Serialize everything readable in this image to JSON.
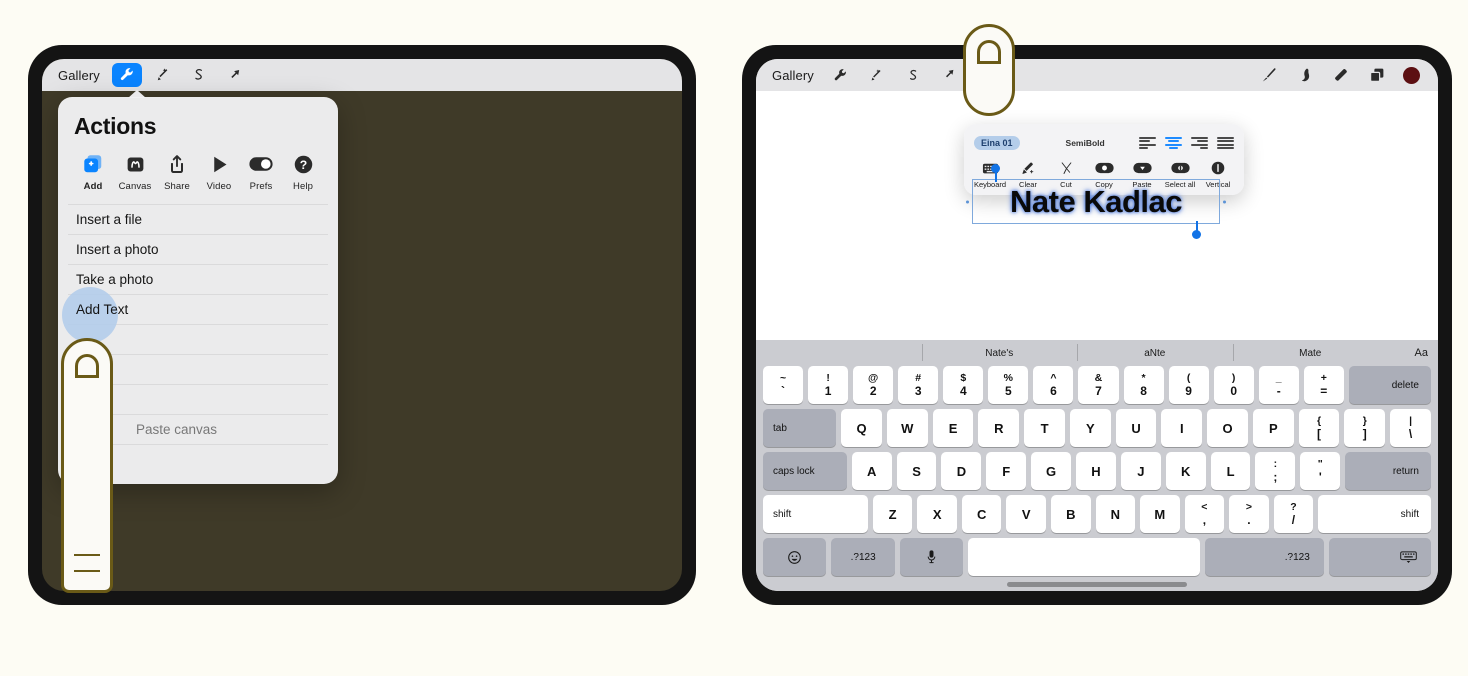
{
  "page": {
    "background_color": "#FDFCF4"
  },
  "left_device": {
    "canvas_color": "#3F3A28",
    "toolbar": {
      "gallery_label": "Gallery",
      "tools": [
        {
          "name": "wrench-icon",
          "label": "Actions",
          "active": true
        },
        {
          "name": "magic-wand-icon",
          "label": "Adjustments",
          "active": false
        },
        {
          "name": "selection-icon",
          "label": "Selection",
          "active": false
        },
        {
          "name": "transform-arrow-icon",
          "label": "Transform",
          "active": false
        }
      ]
    },
    "actions_panel": {
      "title": "Actions",
      "icons": [
        {
          "name": "add-icon",
          "label": "Add",
          "active": true
        },
        {
          "name": "canvas-icon",
          "label": "Canvas",
          "active": false
        },
        {
          "name": "share-icon",
          "label": "Share",
          "active": false
        },
        {
          "name": "video-icon",
          "label": "Video",
          "active": false
        },
        {
          "name": "prefs-icon",
          "label": "Prefs",
          "active": false
        },
        {
          "name": "help-icon",
          "label": "Help",
          "active": false
        }
      ],
      "menu_items": [
        {
          "label": "Insert a file",
          "state": "normal"
        },
        {
          "label": "Insert a photo",
          "state": "normal"
        },
        {
          "label": "Take a photo",
          "state": "normal"
        },
        {
          "label": "Add Text",
          "state": "highlighted"
        },
        {
          "label": "",
          "state": "blank"
        },
        {
          "label": "",
          "state": "blank"
        },
        {
          "label": "",
          "state": "blank"
        },
        {
          "label": "Paste canvas",
          "state": "faded"
        },
        {
          "label": "",
          "state": "blank"
        }
      ]
    },
    "stylus_cursor": {
      "name": "apple-pencil-cursor"
    }
  },
  "right_device": {
    "canvas_color": "#FFFFFF",
    "toolbar": {
      "gallery_label": "Gallery",
      "tools": [
        {
          "name": "wrench-icon",
          "label": "Actions",
          "active": false
        },
        {
          "name": "magic-wand-icon",
          "label": "Adjustments",
          "active": false
        },
        {
          "name": "selection-icon",
          "label": "Selection",
          "active": false
        },
        {
          "name": "transform-arrow-icon",
          "label": "Transform",
          "active": false
        }
      ],
      "right_tools": [
        {
          "name": "brush-icon",
          "label": "Paint"
        },
        {
          "name": "smudge-icon",
          "label": "Smudge"
        },
        {
          "name": "eraser-icon",
          "label": "Erase"
        },
        {
          "name": "layers-icon",
          "label": "Layers"
        }
      ],
      "color_swatch": {
        "name": "color-swatch",
        "hex": "#5C0F12"
      }
    },
    "text_popup": {
      "font_name": "Eina 01",
      "font_weight": "SemiBold",
      "alignment": [
        {
          "name": "align-left-icon",
          "label": "Left",
          "active": false
        },
        {
          "name": "align-center-icon",
          "label": "Center",
          "active": true
        },
        {
          "name": "align-right-icon",
          "label": "Right",
          "active": false
        },
        {
          "name": "align-justify-icon",
          "label": "Justify",
          "active": false
        }
      ],
      "tools": [
        {
          "name": "keyboard-icon",
          "label": "Keyboard"
        },
        {
          "name": "clear-icon",
          "label": "Clear"
        },
        {
          "name": "cut-icon",
          "label": "Cut"
        },
        {
          "name": "copy-icon",
          "label": "Copy"
        },
        {
          "name": "paste-icon",
          "label": "Paste"
        },
        {
          "name": "select-all-icon",
          "label": "Select all"
        },
        {
          "name": "vertical-icon",
          "label": "Vertical"
        }
      ]
    },
    "canvas_text": {
      "value": "Nate Kadlac",
      "selected": true,
      "selection_color": "#1273E6"
    },
    "keyboard": {
      "suggestions": [
        "",
        "Nate's",
        "aNte",
        "Mate"
      ],
      "aa_label": "Aa",
      "rows": [
        [
          {
            "up": "~",
            "lo": "`",
            "type": "dual"
          },
          {
            "up": "!",
            "lo": "1",
            "type": "dual"
          },
          {
            "up": "@",
            "lo": "2",
            "type": "dual"
          },
          {
            "up": "#",
            "lo": "3",
            "type": "dual"
          },
          {
            "up": "$",
            "lo": "4",
            "type": "dual"
          },
          {
            "up": "%",
            "lo": "5",
            "type": "dual"
          },
          {
            "up": "^",
            "lo": "6",
            "type": "dual"
          },
          {
            "up": "&",
            "lo": "7",
            "type": "dual"
          },
          {
            "up": "*",
            "lo": "8",
            "type": "dual"
          },
          {
            "up": "(",
            "lo": "9",
            "type": "dual"
          },
          {
            "up": ")",
            "lo": "0",
            "type": "dual"
          },
          {
            "up": "_",
            "lo": "-",
            "type": "dual"
          },
          {
            "up": "+",
            "lo": "=",
            "type": "dual"
          },
          {
            "label": "delete",
            "type": "mod",
            "cls": "del"
          }
        ],
        [
          {
            "label": "tab",
            "type": "mod",
            "cls": "tab"
          },
          {
            "label": "Q",
            "type": "letter"
          },
          {
            "label": "W",
            "type": "letter"
          },
          {
            "label": "E",
            "type": "letter"
          },
          {
            "label": "R",
            "type": "letter"
          },
          {
            "label": "T",
            "type": "letter"
          },
          {
            "label": "Y",
            "type": "letter"
          },
          {
            "label": "U",
            "type": "letter"
          },
          {
            "label": "I",
            "type": "letter"
          },
          {
            "label": "O",
            "type": "letter"
          },
          {
            "label": "P",
            "type": "letter"
          },
          {
            "up": "{",
            "lo": "[",
            "type": "dual"
          },
          {
            "up": "}",
            "lo": "]",
            "type": "dual"
          },
          {
            "up": "|",
            "lo": "\\",
            "type": "dual"
          }
        ],
        [
          {
            "label": "caps lock",
            "type": "mod",
            "cls": "caps"
          },
          {
            "label": "A",
            "type": "letter"
          },
          {
            "label": "S",
            "type": "letter"
          },
          {
            "label": "D",
            "type": "letter"
          },
          {
            "label": "F",
            "type": "letter"
          },
          {
            "label": "G",
            "type": "letter"
          },
          {
            "label": "H",
            "type": "letter"
          },
          {
            "label": "J",
            "type": "letter"
          },
          {
            "label": "K",
            "type": "letter"
          },
          {
            "label": "L",
            "type": "letter"
          },
          {
            "up": ":",
            "lo": ";",
            "type": "dual"
          },
          {
            "up": "\"",
            "lo": "'",
            "type": "dual"
          },
          {
            "label": "return",
            "type": "mod",
            "cls": "ret"
          }
        ],
        [
          {
            "label": "shift",
            "type": "light",
            "cls": "shiftL"
          },
          {
            "label": "Z",
            "type": "letter"
          },
          {
            "label": "X",
            "type": "letter"
          },
          {
            "label": "C",
            "type": "letter"
          },
          {
            "label": "V",
            "type": "letter"
          },
          {
            "label": "B",
            "type": "letter"
          },
          {
            "label": "N",
            "type": "letter"
          },
          {
            "label": "M",
            "type": "letter"
          },
          {
            "up": "<",
            "lo": ",",
            "type": "dual"
          },
          {
            "up": ">",
            "lo": ".",
            "type": "dual"
          },
          {
            "up": "?",
            "lo": "/",
            "type": "dual"
          },
          {
            "label": "shift",
            "type": "light",
            "cls": "shiftR"
          }
        ],
        [
          {
            "label": "emoji-icon",
            "type": "mod",
            "cls": "bl",
            "icon": "emoji"
          },
          {
            "label": ".?123",
            "type": "mod",
            "cls": "bl"
          },
          {
            "label": "mic-icon",
            "type": "mod",
            "cls": "bl",
            "icon": "mic"
          },
          {
            "label": "",
            "type": "space",
            "cls": "bspace"
          },
          {
            "label": ".?123",
            "type": "mod",
            "cls": "b123r"
          },
          {
            "label": "hide-keyboard-icon",
            "type": "mod",
            "cls": "bkbd",
            "icon": "kbd"
          }
        ]
      ]
    },
    "stylus_cursor": {
      "name": "apple-pencil-cursor"
    }
  }
}
